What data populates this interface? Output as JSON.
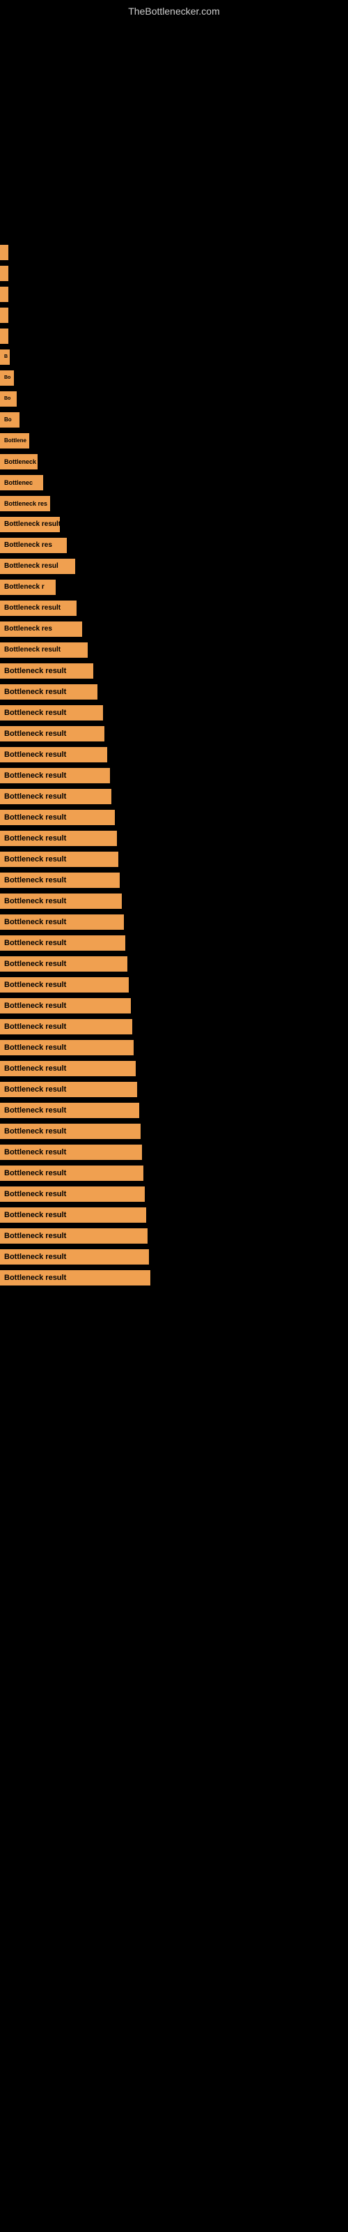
{
  "site": {
    "title": "TheBottlenecker.com"
  },
  "items": [
    {
      "id": 1,
      "label": ""
    },
    {
      "id": 2,
      "label": ""
    },
    {
      "id": 3,
      "label": ""
    },
    {
      "id": 4,
      "label": ""
    },
    {
      "id": 5,
      "label": ""
    },
    {
      "id": 6,
      "label": "B"
    },
    {
      "id": 7,
      "label": "Bo"
    },
    {
      "id": 8,
      "label": "Bo"
    },
    {
      "id": 9,
      "label": "Bo"
    },
    {
      "id": 10,
      "label": "Bottlene"
    },
    {
      "id": 11,
      "label": "Bottleneck r"
    },
    {
      "id": 12,
      "label": "Bottlenec"
    },
    {
      "id": 13,
      "label": "Bottleneck res"
    },
    {
      "id": 14,
      "label": "Bottleneck result"
    },
    {
      "id": 15,
      "label": "Bottleneck res"
    },
    {
      "id": 16,
      "label": "Bottleneck resul"
    },
    {
      "id": 17,
      "label": "Bottleneck r"
    },
    {
      "id": 18,
      "label": "Bottleneck result"
    },
    {
      "id": 19,
      "label": "Bottleneck res"
    },
    {
      "id": 20,
      "label": "Bottleneck result"
    },
    {
      "id": 21,
      "label": "Bottleneck result"
    },
    {
      "id": 22,
      "label": "Bottleneck result"
    },
    {
      "id": 23,
      "label": "Bottleneck result"
    },
    {
      "id": 24,
      "label": "Bottleneck result"
    },
    {
      "id": 25,
      "label": "Bottleneck result"
    },
    {
      "id": 26,
      "label": "Bottleneck result"
    },
    {
      "id": 27,
      "label": "Bottleneck result"
    },
    {
      "id": 28,
      "label": "Bottleneck result"
    },
    {
      "id": 29,
      "label": "Bottleneck result"
    },
    {
      "id": 30,
      "label": "Bottleneck result"
    },
    {
      "id": 31,
      "label": "Bottleneck result"
    },
    {
      "id": 32,
      "label": "Bottleneck result"
    },
    {
      "id": 33,
      "label": "Bottleneck result"
    },
    {
      "id": 34,
      "label": "Bottleneck result"
    },
    {
      "id": 35,
      "label": "Bottleneck result"
    },
    {
      "id": 36,
      "label": "Bottleneck result"
    },
    {
      "id": 37,
      "label": "Bottleneck result"
    },
    {
      "id": 38,
      "label": "Bottleneck result"
    },
    {
      "id": 39,
      "label": "Bottleneck result"
    },
    {
      "id": 40,
      "label": "Bottleneck result"
    },
    {
      "id": 41,
      "label": "Bottleneck result"
    },
    {
      "id": 42,
      "label": "Bottleneck result"
    },
    {
      "id": 43,
      "label": "Bottleneck result"
    },
    {
      "id": 44,
      "label": "Bottleneck result"
    },
    {
      "id": 45,
      "label": "Bottleneck result"
    },
    {
      "id": 46,
      "label": "Bottleneck result"
    },
    {
      "id": 47,
      "label": "Bottleneck result"
    },
    {
      "id": 48,
      "label": "Bottleneck result"
    },
    {
      "id": 49,
      "label": "Bottleneck result"
    },
    {
      "id": 50,
      "label": "Bottleneck result"
    }
  ]
}
